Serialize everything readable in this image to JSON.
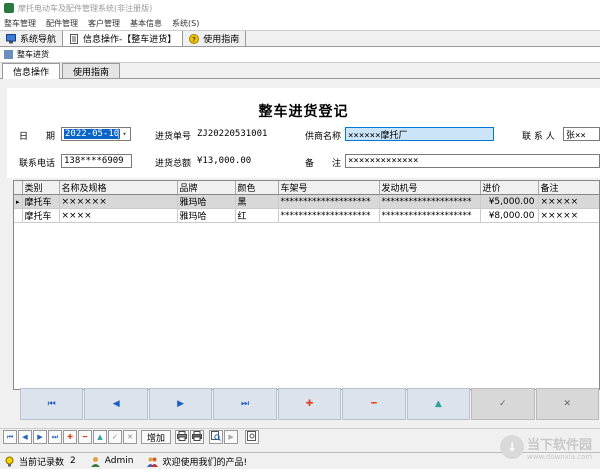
{
  "window": {
    "title": "摩托电动车及配件管理系统(非注册版)"
  },
  "menubar": [
    "整车管理",
    "配件管理",
    "客户管理",
    "基本信息",
    "系统(S)"
  ],
  "nav_tabs": [
    {
      "label": "系统导航",
      "icon": "computer-icon"
    },
    {
      "label": "信息操作-【整车进货】",
      "icon": "document-icon"
    },
    {
      "label": "使用指南",
      "icon": "help-icon"
    }
  ],
  "subwindow": {
    "title": "整车进货"
  },
  "inner_tabs": [
    "信息操作",
    "使用指南"
  ],
  "form": {
    "title": "整车进货登记",
    "date_label": "日　　期",
    "date_value": "2022-05-10",
    "order_no_label": "进货单号",
    "order_no_value": "ZJ20220531001",
    "supplier_label": "供商名称",
    "supplier_value": "××××××摩托厂",
    "contact_label": "联 系 人",
    "contact_value": "张××",
    "phone_label": "联系电话",
    "phone_value": "138****6909",
    "total_label": "进货总额",
    "total_value": "¥13,000.00",
    "remark_label": "备　　注",
    "remark_value": "×××××××××××××"
  },
  "grid": {
    "columns": [
      "类别",
      "名称及规格",
      "品牌",
      "颜色",
      "车架号",
      "发动机号",
      "进价",
      "备注"
    ],
    "rows": [
      [
        "摩托车",
        "××××××",
        "雅玛哈",
        "黑",
        "********************",
        "********************",
        "¥5,000.00",
        "×××××"
      ],
      [
        "摩托车",
        "××××",
        "雅玛哈",
        "红",
        "********************",
        "********************",
        "¥8,000.00",
        "×××××"
      ]
    ]
  },
  "nav_buttons": [
    {
      "symbol": "⏮",
      "color": "#1f5fbf"
    },
    {
      "symbol": "◀",
      "color": "#1f5fbf"
    },
    {
      "symbol": "▶",
      "color": "#1f5fbf"
    },
    {
      "symbol": "⏭",
      "color": "#1f5fbf"
    },
    {
      "symbol": "✚",
      "color": "#e04020"
    },
    {
      "symbol": "━",
      "color": "#e04020"
    },
    {
      "symbol": "▲",
      "color": "#2aa0a0"
    },
    {
      "symbol": "✓",
      "color": "#666666"
    },
    {
      "symbol": "✕",
      "color": "#666666"
    }
  ],
  "toolbar": {
    "add_label": "增加"
  },
  "statusbar": {
    "record_label": "当前记录数",
    "record_count": "2",
    "user": "Admin",
    "welcome": "欢迎使用我们的产品!"
  },
  "watermark": {
    "text": "当下软件园",
    "url": "www.downxia.com"
  },
  "colors": {
    "selection": "#0a64c8",
    "highlight_field": "#cce4f7",
    "nav_button": "#dde3ec"
  }
}
